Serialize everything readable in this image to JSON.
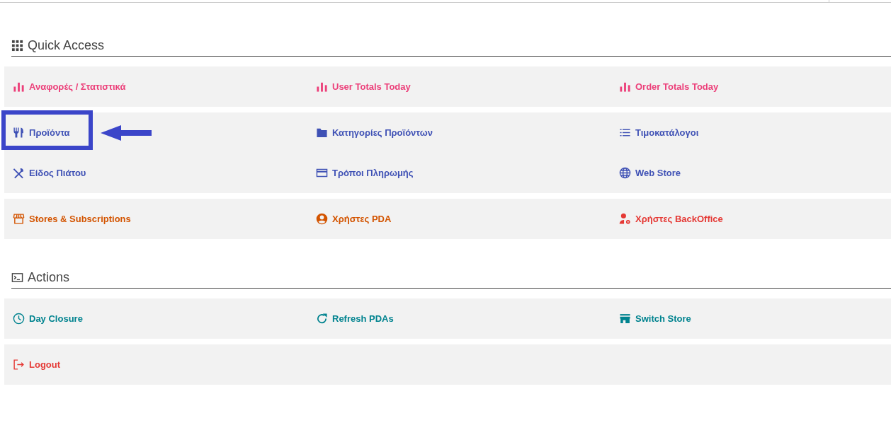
{
  "sections": [
    {
      "title": "Quick Access",
      "panels": [
        {
          "rows": [
            [
              {
                "label": "Αναφορές / Στατιστικά",
                "color": "#ec407a",
                "highlighted": false
              },
              {
                "label": "User Totals Today",
                "color": "#ec407a",
                "highlighted": false
              },
              {
                "label": "Order Totals Today",
                "color": "#ec407a",
                "highlighted": false
              }
            ]
          ]
        },
        {
          "rows": [
            [
              {
                "label": "Προϊόντα",
                "color": "#3f51b5",
                "highlighted": true
              },
              {
                "label": "Κατηγορίες Προϊόντων",
                "color": "#3f51b5",
                "highlighted": false
              },
              {
                "label": "Τιμοκατάλογοι",
                "color": "#3f51b5",
                "highlighted": false
              }
            ],
            [
              {
                "label": "Είδος Πιάτου",
                "color": "#3f51b5",
                "highlighted": false
              },
              {
                "label": "Τρόποι Πληρωμής",
                "color": "#3f51b5",
                "highlighted": false
              },
              {
                "label": "Web Store",
                "color": "#3f51b5",
                "highlighted": false
              }
            ]
          ]
        },
        {
          "rows": [
            [
              {
                "label": "Stores & Subscriptions",
                "color": "#d35400",
                "highlighted": false
              },
              {
                "label": "Χρήστες PDA",
                "color": "#d35400",
                "highlighted": false
              },
              {
                "label": "Χρήστες BackOffice",
                "color": "#e53935",
                "highlighted": false
              }
            ]
          ]
        }
      ]
    },
    {
      "title": "Actions",
      "panels": [
        {
          "rows": [
            [
              {
                "label": "Day Closure",
                "color": "#00838f",
                "highlighted": false
              },
              {
                "label": "Refresh PDAs",
                "color": "#00838f",
                "highlighted": false
              },
              {
                "label": "Switch Store",
                "color": "#00838f",
                "highlighted": false
              }
            ]
          ]
        },
        {
          "rows": [
            [
              {
                "label": "Logout",
                "color": "#e53935",
                "highlighted": false
              }
            ]
          ]
        }
      ]
    }
  ]
}
